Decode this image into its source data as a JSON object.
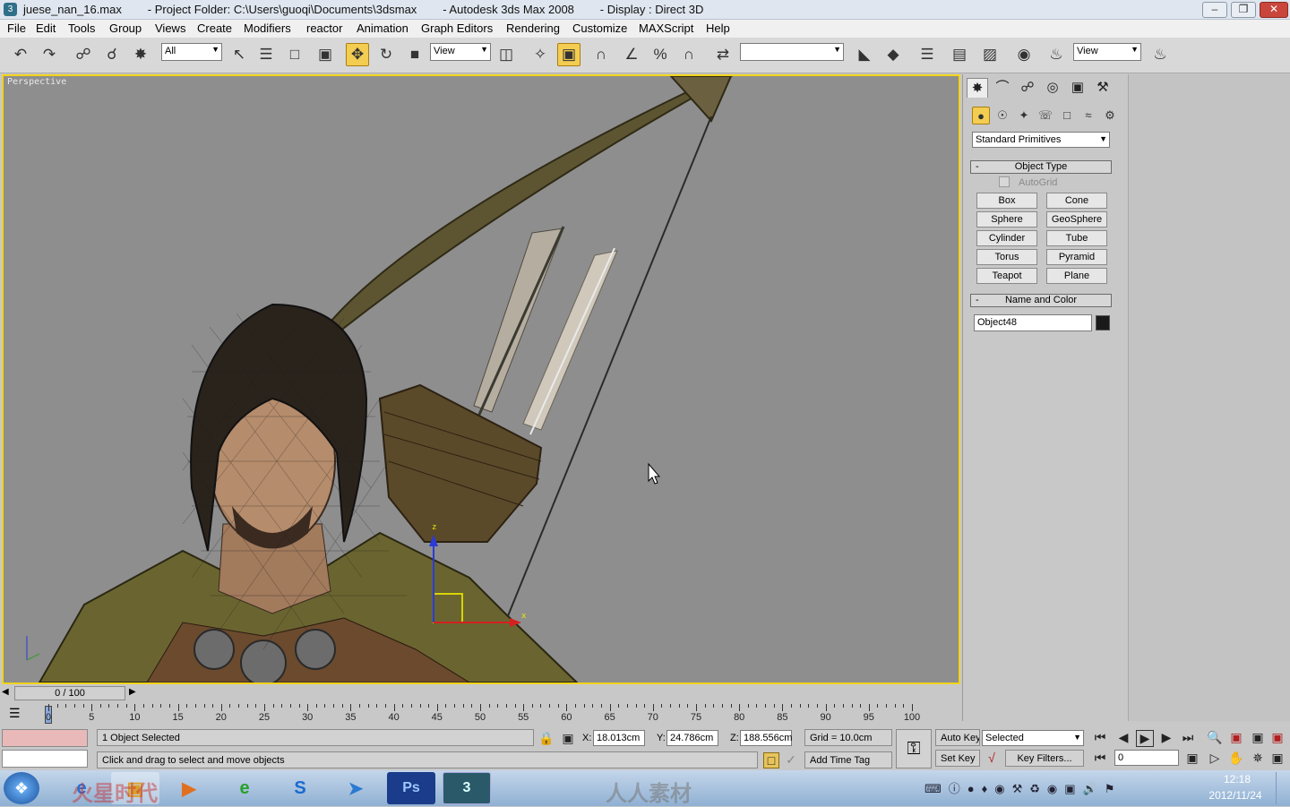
{
  "titlebar": {
    "app_icon": "3",
    "title": "juese_nan_16.max        - Project Folder: C:\\Users\\guoqi\\Documents\\3dsmax        - Autodesk 3ds Max 2008        - Display : Direct 3D"
  },
  "menu": [
    "File",
    "Edit",
    "Tools",
    "Group",
    "Views",
    "Create",
    "Modifiers",
    "reactor",
    "Animation",
    "Graph Editors",
    "Rendering",
    "Customize",
    "MAXScript",
    "Help"
  ],
  "toolbar": {
    "selection_filter": "All",
    "ref_coord_1": "View",
    "named_selection": "",
    "ref_coord_2": "View"
  },
  "viewport": {
    "label": "Perspective",
    "gizmo_z": "z",
    "gizmo_x": "x"
  },
  "command_panel": {
    "primitive_type": "Standard Primitives",
    "object_type_header": "Object Type",
    "autogrid": "AutoGrid",
    "buttons": [
      "Box",
      "Cone",
      "Sphere",
      "GeoSphere",
      "Cylinder",
      "Tube",
      "Torus",
      "Pyramid",
      "Teapot",
      "Plane"
    ],
    "name_color_header": "Name and Color",
    "object_name": "Object48",
    "object_color": "#1a1a1a"
  },
  "timeline": {
    "slider": "0 / 100",
    "ticks": [
      "0",
      "5",
      "10",
      "15",
      "20",
      "25",
      "30",
      "35",
      "40",
      "45",
      "50",
      "55",
      "60",
      "65",
      "70",
      "75",
      "80",
      "85",
      "90",
      "95",
      "100"
    ]
  },
  "status": {
    "selection": "1 Object Selected",
    "prompt": "Click and drag to select and move objects",
    "x_label": "X:",
    "x_value": "18.013cm",
    "y_label": "Y:",
    "y_value": "24.786cm",
    "z_label": "Z:",
    "z_value": "188.556cm",
    "grid": "Grid = 10.0cm",
    "add_time_tag": "Add Time Tag",
    "auto_key": "Auto Key",
    "set_key": "Set Key",
    "key_mode": "Selected",
    "key_filters": "Key Filters...",
    "frame": "0"
  },
  "taskbar": {
    "time": "12:18",
    "date": "2012/11/24",
    "apps": [
      "Ps",
      "3"
    ],
    "watermark_1": "火星时代",
    "watermark_2": "人人素材"
  },
  "colors": {
    "viewport_border": "#f2d31c",
    "active_button": "#f3cc52",
    "viewport_bg": "#8e8e8e"
  }
}
